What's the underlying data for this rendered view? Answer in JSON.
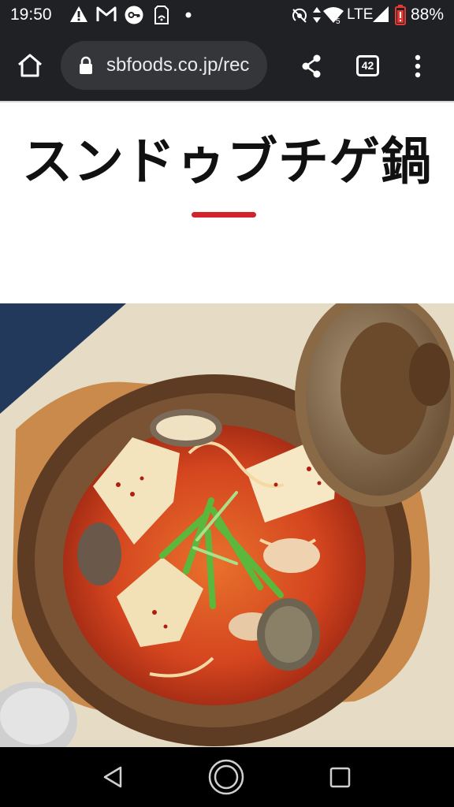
{
  "status_bar": {
    "time": "19:50",
    "network": "LTE",
    "battery": "88%",
    "icons": [
      "warning-icon",
      "gmail-icon",
      "key-icon",
      "sim-icon",
      "dot-icon",
      "hotspot-icon",
      "data-arrows-icon",
      "wifi-icon",
      "signal-icon",
      "battery-icon"
    ]
  },
  "browser": {
    "url": "sbfoods.co.jp/rec",
    "tab_count": "42",
    "icons": [
      "home-icon",
      "lock-icon",
      "share-icon",
      "tabs-icon",
      "more-vert-icon"
    ]
  },
  "page": {
    "title": "スンドゥブチゲ鍋",
    "accent_color": "#d2232a",
    "hero_image": "sundubu-jjigae-photo"
  },
  "nav_bar": {
    "icons": [
      "back-icon",
      "home-nav-icon",
      "recents-icon"
    ]
  }
}
